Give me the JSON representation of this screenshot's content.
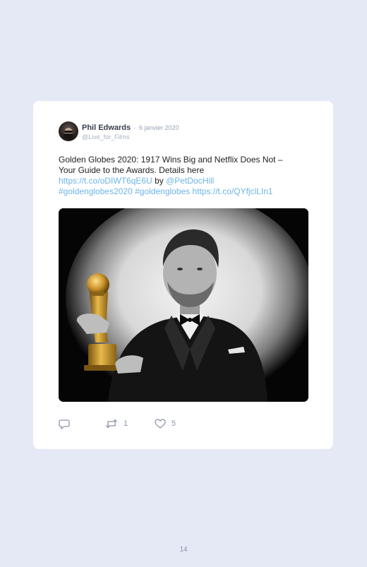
{
  "tweet": {
    "author_name": "Phil Edwards",
    "separator": "·",
    "date": "6 janvier 2020",
    "handle": "@Live_for_Films",
    "text_line1": "Golden Globes 2020: 1917 Wins Big and Netflix Does Not –",
    "text_line2": "Your Guide to the Awards. Details here",
    "link1": "https://t.co/oDIWT6qE6U",
    "by_text": "by",
    "mention": "@PetDocHill",
    "hashtag1": "#goldenglobes2020",
    "hashtag2": "#goldenglobes",
    "link2": "https://t.co/QYfjclLIn1",
    "actions": {
      "reply_icon": "reply-icon",
      "retweet_icon": "retweet-icon",
      "retweet_count": "1",
      "like_icon": "heart-icon",
      "like_count": "5"
    }
  },
  "footer": {
    "page_number": "14"
  },
  "colors": {
    "background": "#e5e8f5",
    "card": "#ffffff",
    "link": "#6cb4e6",
    "text": "#222222",
    "muted": "#8a93a6"
  }
}
